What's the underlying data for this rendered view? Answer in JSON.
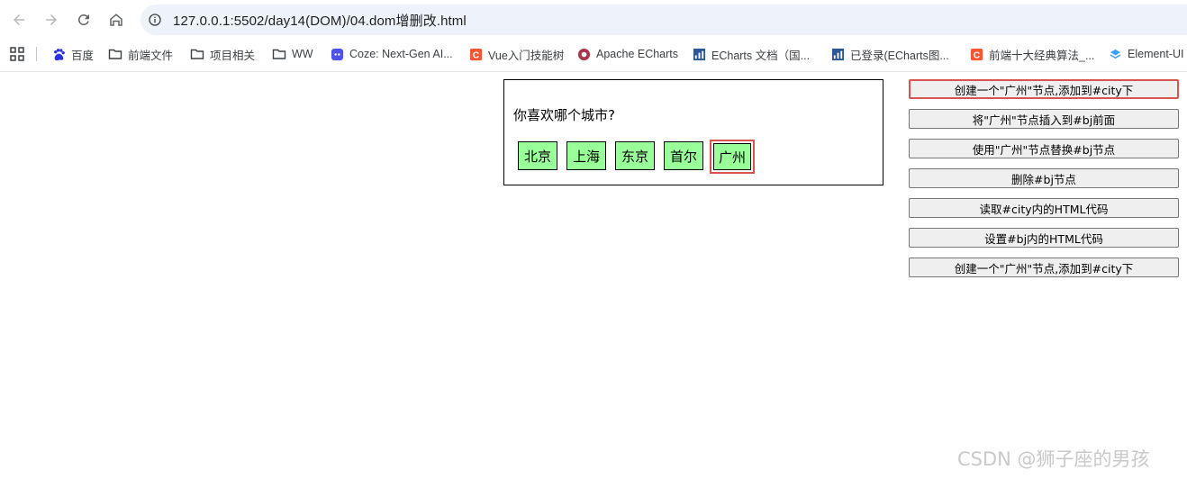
{
  "browser": {
    "url": "127.0.0.1:5502/day14(DOM)/04.dom增删改.html",
    "bookmarks": [
      {
        "label": "百度",
        "icon": "baidu-icon"
      },
      {
        "label": "前端文件",
        "icon": "folder-icon"
      },
      {
        "label": "项目相关",
        "icon": "folder-icon"
      },
      {
        "label": "WW",
        "icon": "folder-icon"
      },
      {
        "label": "Coze: Next-Gen AI...",
        "icon": "coze-icon"
      },
      {
        "label": "Vue入门技能树",
        "icon": "csdn-icon"
      },
      {
        "label": "Apache ECharts",
        "icon": "echarts-icon"
      },
      {
        "label": "ECharts 文档（国...",
        "icon": "chart-icon"
      },
      {
        "label": "已登录(ECharts图...",
        "icon": "chart-icon"
      },
      {
        "label": "前端十大经典算法_...",
        "icon": "csdn-icon"
      },
      {
        "label": "Element-UI",
        "icon": "element-icon"
      }
    ]
  },
  "page": {
    "question": "你喜欢哪个城市?",
    "cities": [
      {
        "label": "北京",
        "highlighted": false
      },
      {
        "label": "上海",
        "highlighted": false
      },
      {
        "label": "东京",
        "highlighted": false
      },
      {
        "label": "首尔",
        "highlighted": false
      },
      {
        "label": "广州",
        "highlighted": true
      }
    ],
    "buttons": [
      {
        "label": "创建一个\"广州\"节点,添加到#city下",
        "active": true
      },
      {
        "label": "将\"广州\"节点插入到#bj前面",
        "active": false
      },
      {
        "label": "使用\"广州\"节点替换#bj节点",
        "active": false
      },
      {
        "label": "删除#bj节点",
        "active": false
      },
      {
        "label": "读取#city内的HTML代码",
        "active": false
      },
      {
        "label": "设置#bj内的HTML代码",
        "active": false
      },
      {
        "label": "创建一个\"广州\"节点,添加到#city下",
        "active": false
      }
    ]
  },
  "watermark": "CSDN @狮子座的男孩",
  "colors": {
    "city_bg": "#99ff99",
    "highlight": "#d9534f",
    "omnibox_bg": "#eef2fa"
  }
}
